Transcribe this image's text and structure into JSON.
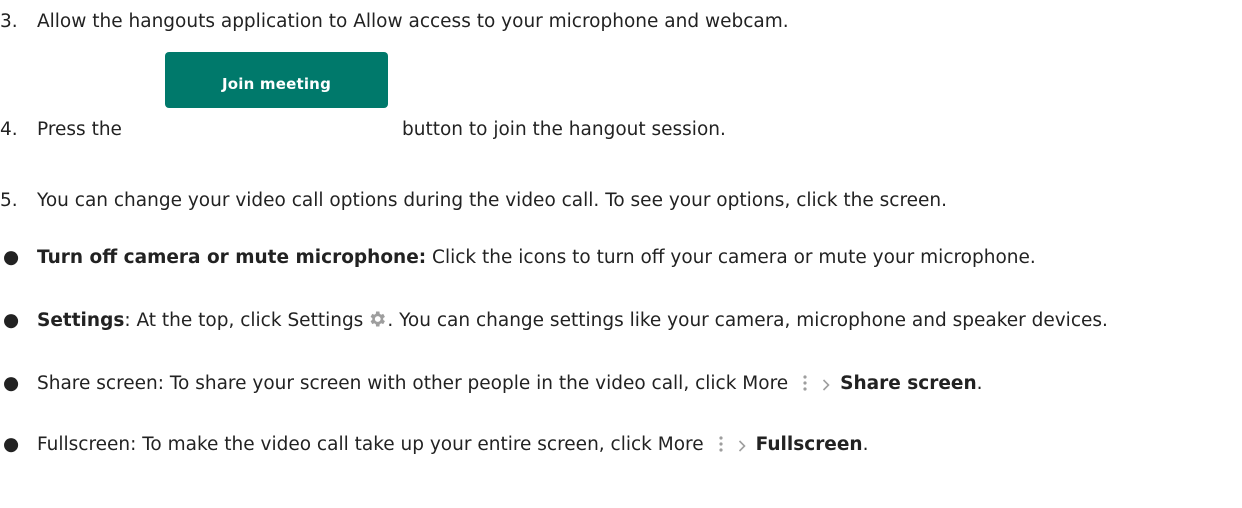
{
  "steps": {
    "step3": {
      "num": "3.",
      "text": "Allow the hangouts application to Allow access to your microphone and webcam."
    },
    "step4": {
      "num": "4.",
      "pre": "Press the",
      "button_label": "Join meeting",
      "post": "button to join the hangout session."
    },
    "step5": {
      "num": "5.",
      "text": "You can change your video call options during the video call. To see your options, click the screen."
    }
  },
  "bullets": {
    "glyph": "●",
    "b1": {
      "title": "Turn off camera or mute microphone:",
      "text": " Click the icons to turn off your camera or mute your microphone."
    },
    "b2": {
      "title": "Settings",
      "text1": ": At the top, click Settings",
      "text2": ". You can change settings like your camera, microphone and speaker devices."
    },
    "b3": {
      "text1": "Share screen: To share your screen with other people in the video call, click More",
      "bold": "Share screen",
      "text2": "."
    },
    "b4": {
      "text1": "Fullscreen: To make the video call take up your entire screen, click More",
      "bold": "Fullscreen",
      "text2": "."
    }
  },
  "colors": {
    "button_bg": "#00796b",
    "text": "#222222",
    "icon_gray": "#9e9e9e"
  },
  "icons": {
    "settings": "gear-icon",
    "more": "more-vert-icon",
    "chevron": "chevron-right-icon"
  }
}
